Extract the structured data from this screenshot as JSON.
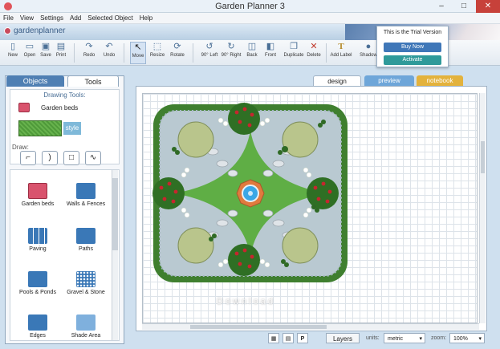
{
  "window": {
    "title": "Garden Planner 3",
    "minimize": "–",
    "maximize": "□",
    "close": "✕"
  },
  "menu": [
    "File",
    "View",
    "Settings",
    "Add",
    "Selected Object",
    "Help"
  ],
  "brand": "gardenplanner",
  "toolbar": {
    "new": "New",
    "open": "Open",
    "save": "Save",
    "print": "Print",
    "redo": "Redo",
    "undo": "Undo",
    "move": "Move",
    "resize": "Resize",
    "rotate": "Rotate",
    "left90": "90° Left",
    "right90": "90° Right",
    "back": "Back",
    "front": "Front",
    "duplicate": "Duplicate",
    "delete": "Delete",
    "addlabel": "Add Label",
    "shadow": "Shadow"
  },
  "trial": {
    "message": "This is the Trial Version",
    "buy": "Buy Now",
    "activate": "Activate"
  },
  "left_tabs": {
    "objects": "Objects",
    "tools": "Tools"
  },
  "drawing_tools": {
    "heading": "Drawing Tools:",
    "selected": "Garden beds",
    "style": "style",
    "draw_label": "Draw:"
  },
  "objects": [
    {
      "label": "Garden beds"
    },
    {
      "label": "Walls & Fences"
    },
    {
      "label": "Paving"
    },
    {
      "label": "Paths"
    },
    {
      "label": "Pools & Ponds"
    },
    {
      "label": "Gravel & Stone"
    },
    {
      "label": "Edges"
    },
    {
      "label": "Shade Area"
    }
  ],
  "view_tabs": {
    "design": "design",
    "preview": "preview",
    "notebook": "notebook"
  },
  "bottom": {
    "layers": "Layers",
    "units_label": "units:",
    "units": "metric",
    "zoom_label": "zoom:",
    "zoom": "100%"
  },
  "watermark": "Download",
  "colors": {
    "accent": "#4f7fb3",
    "preview_tab": "#6ea6d9",
    "notebook_tab": "#e3b23c",
    "lawn": "#5fae45",
    "hedge": "#3f7f2f",
    "buy": "#3f77b8",
    "activate": "#2f9a9a"
  }
}
